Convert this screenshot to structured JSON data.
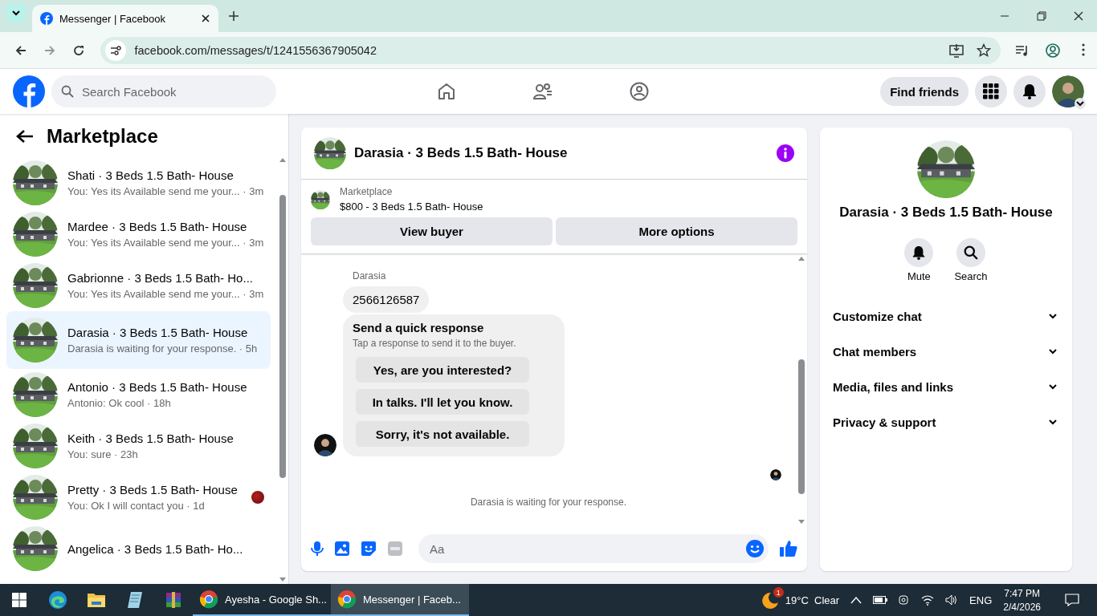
{
  "browser": {
    "tab_title": "Messenger | Facebook",
    "url": "facebook.com/messages/t/1241556367905042"
  },
  "header": {
    "search_placeholder": "Search Facebook",
    "find_friends": "Find friends"
  },
  "sidebar": {
    "title": "Marketplace",
    "conversations": [
      {
        "name": "Shati · 3 Beds 1.5 Bath- House",
        "preview": "You: Yes its Available send me your... · 3m",
        "selected": false,
        "seen_marker": false
      },
      {
        "name": "Mardee · 3 Beds 1.5 Bath- House",
        "preview": "You: Yes its Available send me your... · 3m",
        "selected": false,
        "seen_marker": false
      },
      {
        "name": "Gabrionne · 3 Beds 1.5 Bath- Ho...",
        "preview": "You: Yes its Available send me your... · 3m",
        "selected": false,
        "seen_marker": false
      },
      {
        "name": "Darasia · 3 Beds 1.5 Bath- House",
        "preview": "Darasia is waiting for your response. · 5h",
        "selected": true,
        "seen_marker": false
      },
      {
        "name": "Antonio · 3 Beds 1.5 Bath- House",
        "preview": "Antonio: Ok cool · 18h",
        "selected": false,
        "seen_marker": false
      },
      {
        "name": "Keith · 3 Beds 1.5 Bath- House",
        "preview": "You: sure · 23h",
        "selected": false,
        "seen_marker": false
      },
      {
        "name": "Pretty · 3 Beds 1.5 Bath- House",
        "preview": "You: Ok I will contact you · 1d",
        "selected": false,
        "seen_marker": true
      },
      {
        "name": "Angelica · 3 Beds 1.5 Bath- Ho...",
        "selected": false,
        "seen_marker": false
      }
    ]
  },
  "chat": {
    "title": "Darasia · 3 Beds 1.5 Bath- House",
    "listing": {
      "label": "Marketplace",
      "title": "$800 - 3 Beds 1.5 Bath- House"
    },
    "buttons": [
      "View buyer",
      "More options"
    ],
    "sender": "Darasia",
    "message": "2566126587",
    "quick_response": {
      "title": "Send a quick response",
      "subtitle": "Tap a response to send it to the buyer.",
      "options": [
        "Yes, are you interested?",
        "In talks. I'll let you know.",
        "Sorry, it's not available."
      ]
    },
    "status": "Darasia is waiting for your response.",
    "composer_placeholder": "Aa"
  },
  "details": {
    "name": "Darasia · 3 Beds 1.5 Bath- House",
    "actions": [
      {
        "kind": "mute",
        "label": "Mute"
      },
      {
        "kind": "search",
        "label": "Search"
      }
    ],
    "sections": [
      "Customize chat",
      "Chat members",
      "Media, files and links",
      "Privacy & support"
    ]
  },
  "taskbar": {
    "windows": [
      {
        "label": "Ayesha - Google Sh...",
        "selected": false
      },
      {
        "label": "Messenger | Faceb...",
        "selected": true
      }
    ],
    "weather_badge": "1",
    "temperature": "19°C",
    "condition": "Clear",
    "language": "ENG",
    "time": "7:47 PM",
    "date": "2/4/2026"
  }
}
